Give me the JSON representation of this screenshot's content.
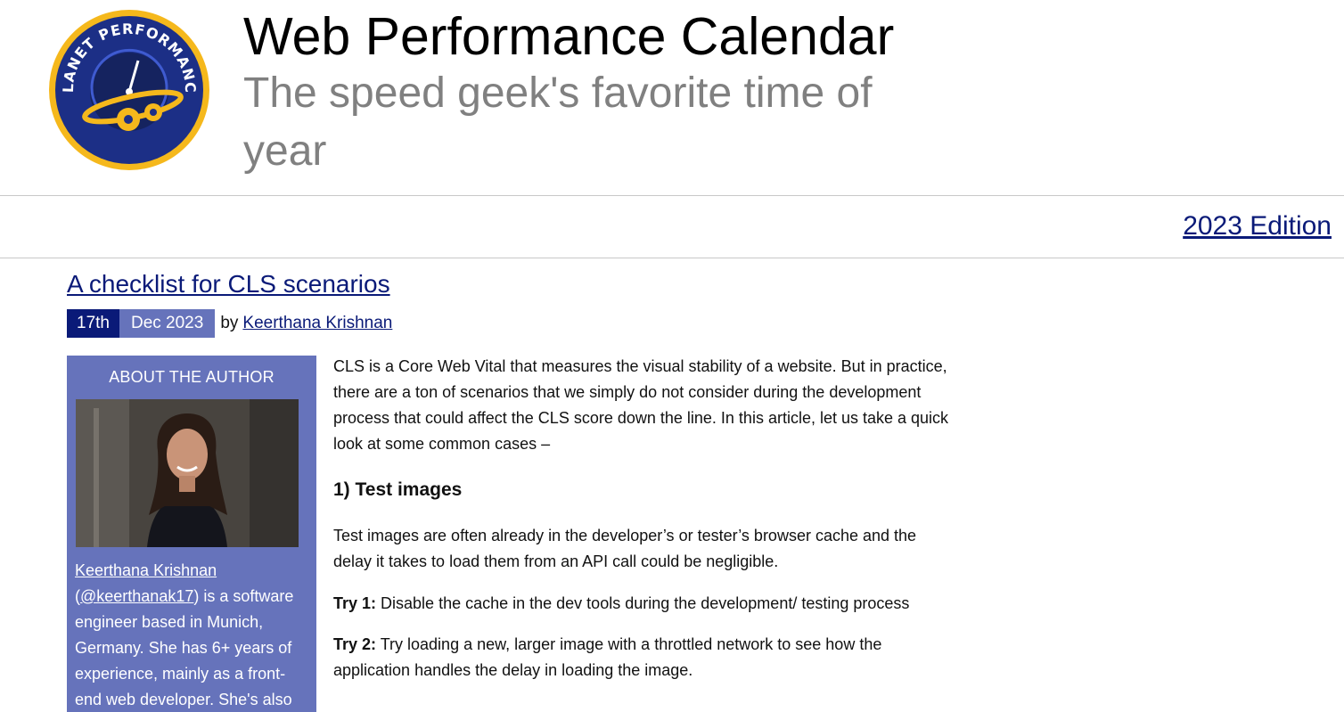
{
  "site": {
    "title": "Web Performance Calendar",
    "tagline": "The speed geek's favorite time of year",
    "logo_text": "PLANET PERFORMANCE",
    "edition_link": "2023 Edition"
  },
  "post": {
    "title": "A checklist for CLS scenarios",
    "date_day": "17th",
    "date_month_year": "Dec 2023",
    "by": "by",
    "author": "Keerthana Krishnan"
  },
  "sidebar": {
    "heading": "ABOUT THE AUTHOR",
    "bio_name": "Keerthana Krishnan",
    "bio_open": "(",
    "bio_handle": "@keerthanak17",
    "bio_text": ") is a software engineer based in Munich, Germany. She has 6+ years of experience, mainly as a front-end web developer. She's also"
  },
  "article": {
    "intro": "CLS is a Core Web Vital that measures the visual stability of a website. But in practice, there are a ton of scenarios that we simply do not consider during the development process that could affect the CLS score down the line. In this article, let us take a quick look at some common cases –",
    "section1_heading": "1) Test images",
    "section1_text": "Test images are often already in the developer’s or tester’s browser cache and the delay it takes to load them from an API call could be negligible.",
    "try1_label": "Try 1:",
    "try1_text": " Disable the cache in the dev tools during the development/ testing process",
    "try2_label": "Try 2:",
    "try2_text": " Try loading a new, larger image with a throttled network to see how the application handles the delay in loading the image."
  },
  "colors": {
    "navy": "#0a1a78",
    "periwinkle": "#6673bb",
    "logo_gold": "#f5b81c",
    "logo_blue": "#1c2f86"
  },
  "icons": {
    "logo": "planet-performance-speedometer-gears-logo"
  }
}
